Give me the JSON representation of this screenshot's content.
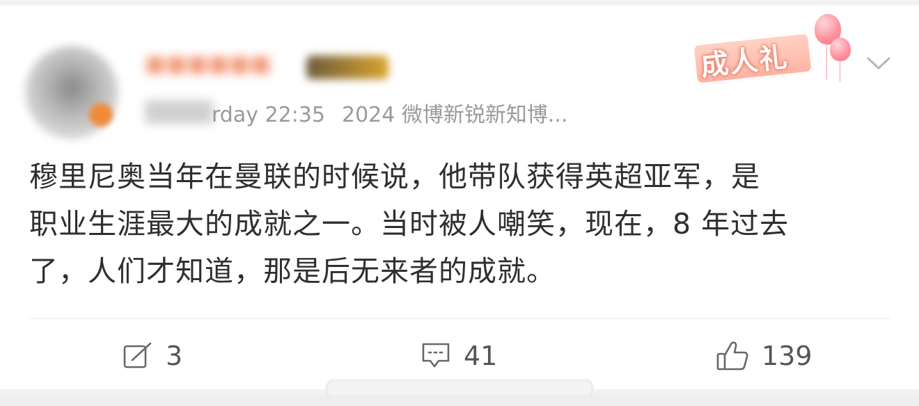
{
  "post": {
    "meta": {
      "time": "rday 22:35",
      "source": "2024 微博新锐新知博..."
    },
    "stamp_label": "成人礼",
    "body_lines": [
      "穆里尼奥当年在曼联的时候说，他带队获得英超亚军，是",
      "职业生涯最大的成就之一。当时被人嘲笑，现在，8 年过去",
      "了，人们才知道，那是后无来者的成就。"
    ],
    "actions": {
      "repost_count": "3",
      "comment_count": "41",
      "like_count": "139"
    }
  },
  "icons": {
    "dropdown": "chevron-down-icon",
    "repost": "repost-icon",
    "comment": "comment-icon",
    "like": "thumbs-up-icon"
  },
  "colors": {
    "meta_text": "#9a9a9a",
    "body_text": "#2f2f2f",
    "action_text": "#555555",
    "stamp_accent": "#e56e5a"
  }
}
